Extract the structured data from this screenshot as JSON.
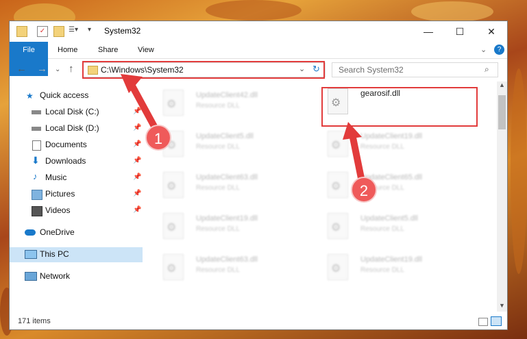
{
  "window": {
    "title": "System32",
    "controls": {
      "minimize": "—",
      "maximize": "☐",
      "close": "✕"
    }
  },
  "ribbon": {
    "tabs": [
      "File",
      "Home",
      "Share",
      "View"
    ]
  },
  "address_bar": {
    "path": "C:\\Windows\\System32"
  },
  "search": {
    "placeholder": "Search System32"
  },
  "nav_pane": {
    "items": [
      {
        "label": "Quick access",
        "icon": "star-icon"
      },
      {
        "label": "Local Disk (C:)",
        "icon": "drive-icon",
        "pinned": true
      },
      {
        "label": "Local Disk (D:)",
        "icon": "drive-icon",
        "pinned": true
      },
      {
        "label": "Documents",
        "icon": "documents-icon",
        "pinned": true
      },
      {
        "label": "Downloads",
        "icon": "downloads-icon",
        "pinned": true
      },
      {
        "label": "Music",
        "icon": "music-icon",
        "pinned": true
      },
      {
        "label": "Pictures",
        "icon": "pictures-icon",
        "pinned": true
      },
      {
        "label": "Videos",
        "icon": "videos-icon",
        "pinned": true
      },
      {
        "label": "OneDrive",
        "icon": "cloud-icon"
      },
      {
        "label": "This PC",
        "icon": "computer-icon",
        "selected": true
      },
      {
        "label": "Network",
        "icon": "network-icon"
      }
    ]
  },
  "files": [
    {
      "name": "UpdateClient42.dll",
      "type": "Resource DLL"
    },
    {
      "name": "gearosif.dll",
      "type": ""
    },
    {
      "name": "UpdateClient5.dll",
      "type": "Resource DLL"
    },
    {
      "name": "UpdateClient19.dll",
      "type": "Resource DLL"
    },
    {
      "name": "UpdateClient63.dll",
      "type": "Resource DLL"
    },
    {
      "name": "UpdateClient65.dll",
      "type": "Resource DLL"
    },
    {
      "name": "UpdateClient19.dll",
      "type": "Resource DLL"
    },
    {
      "name": "UpdateClient5.dll",
      "type": "Resource DLL"
    },
    {
      "name": "UpdateClient63.dll",
      "type": "Resource DLL"
    },
    {
      "name": "UpdateClient19.dll",
      "type": "Resource DLL"
    }
  ],
  "status": {
    "item_count": "171 items"
  },
  "annotations": {
    "step1": "1",
    "step2": "2",
    "color": "#e23b3b"
  }
}
